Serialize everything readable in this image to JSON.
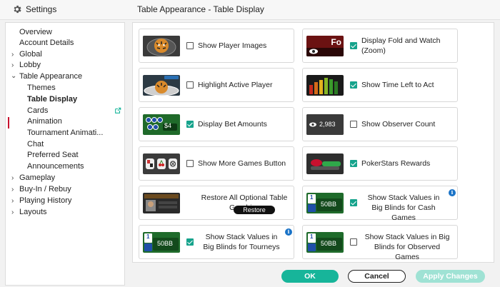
{
  "header": {
    "settings_label": "Settings",
    "section_title": "Table Appearance - Table Display"
  },
  "sidebar": {
    "items": [
      {
        "label": "Overview"
      },
      {
        "label": "Account Details"
      },
      {
        "label": "Global"
      },
      {
        "label": "Lobby"
      },
      {
        "label": "Table Appearance"
      },
      {
        "label": "Themes"
      },
      {
        "label": "Table Display"
      },
      {
        "label": "Cards"
      },
      {
        "label": "Animation"
      },
      {
        "label": "Tournament Animati..."
      },
      {
        "label": "Chat"
      },
      {
        "label": "Preferred Seat"
      },
      {
        "label": "Announcements"
      },
      {
        "label": "Gameplay"
      },
      {
        "label": "Buy-In / Rebuy"
      },
      {
        "label": "Playing History"
      },
      {
        "label": "Layouts"
      }
    ],
    "active": "Table Display"
  },
  "options": {
    "show_player_images": {
      "label": "Show Player Images",
      "checked": false
    },
    "display_fold_watch": {
      "label": "Display Fold and Watch (Zoom)",
      "checked": true,
      "thumb_text": "Fo"
    },
    "highlight_active_player": {
      "label": "Highlight Active Player",
      "checked": false
    },
    "show_time_left": {
      "label": "Show Time Left to Act",
      "checked": true
    },
    "display_bet_amounts": {
      "label": "Display Bet Amounts",
      "checked": true,
      "thumb_text": "$4"
    },
    "show_observer_count": {
      "label": "Show Observer Count",
      "checked": false,
      "thumb_text": "2,983"
    },
    "show_more_games": {
      "label": "Show More Games Button",
      "checked": false
    },
    "pokerstars_rewards": {
      "label": "PokerStars Rewards",
      "checked": true
    },
    "restore_graphics": {
      "label": "Restore All Optional Table Graphics",
      "button": "Restore"
    },
    "stack_big_blinds_cash": {
      "label": "Show Stack Values in Big Blinds for Cash Games",
      "checked": true,
      "thumb_text": "50BB"
    },
    "stack_big_blinds_tourneys": {
      "label": "Show Stack Values in Big Blinds for Tourneys",
      "checked": true,
      "thumb_text": "50BB"
    },
    "stack_big_blinds_observed": {
      "label": "Show Stack Values in Big Blinds for Observed Games",
      "checked": false,
      "thumb_text": "50BB"
    }
  },
  "footer": {
    "ok": "OK",
    "cancel": "Cancel",
    "apply": "Apply Changes"
  },
  "colors": {
    "accent": "#17b59a",
    "checked": "#16a38c",
    "active_marker": "#c8102e",
    "info": "#1a73c7",
    "apply_disabled": "#9fe2d4"
  }
}
